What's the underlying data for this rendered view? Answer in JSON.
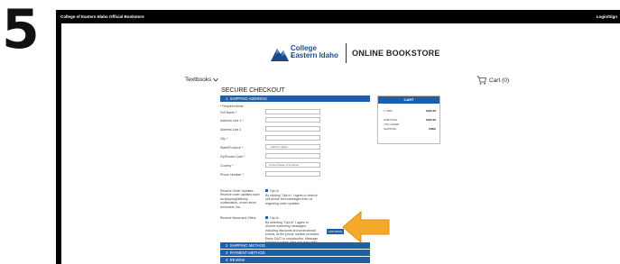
{
  "step_number": "5",
  "topbar": {
    "store_name": "College of Eastern Idaho Official Bookstore",
    "login_label": "Login/Sign"
  },
  "header": {
    "college_line1": "College",
    "college_of": "of",
    "college_line2": "Eastern Idaho",
    "store_title": "ONLINE BOOKSTORE"
  },
  "nav": {
    "textbooks_label": "Textbooks",
    "textbooks_chevron": "chevron-down-icon",
    "cart_label": "Cart (0)",
    "cart_icon": "cart-icon"
  },
  "checkout": {
    "title": "SECURE CHECKOUT",
    "sections": {
      "shipping_address": "1. SHIPPING ADDRESS",
      "shipping_method": "2. SHIPPING METHOD",
      "payment_method": "3. PAYMENT METHOD",
      "review": "4. REVIEW"
    },
    "required_note": "* Required fields",
    "fields": [
      {
        "label": "Full Name *",
        "value": ""
      },
      {
        "label": "Address Line 1 *",
        "value": ""
      },
      {
        "label": "Address Line 2",
        "value": ""
      },
      {
        "label": "City *",
        "value": ""
      },
      {
        "label": "State/Province *",
        "value": "- Select a State -"
      },
      {
        "label": "Zip/Postal Code *",
        "value": ""
      },
      {
        "label": "Country *",
        "value": "United States of America"
      },
      {
        "label": "Phone Number *",
        "value": ""
      }
    ],
    "order_updates": {
      "label": "Receive Order Updates",
      "sub_label": "Receive order updates such as shipping/delivery confirmation, some return reminders, etc.",
      "checkbox_label": "Opt-In",
      "description": "By clicking \"Opt-In\" I agree to receive cell phone text messages from us regarding order updates."
    },
    "news_offers": {
      "label": "Receive News and Offers",
      "checkbox_label": "Opt-In",
      "description": "By selecting \"Opt-In\" I agree to receive marketing messages, including discounts and promotional events, at the phone number provided. Reply QUIT to unsubscribe. Message frequency varies. Msg and data rates may apply."
    },
    "continue_label": "CONTINUE"
  },
  "cart_summary": {
    "title": "CART",
    "rows": [
      {
        "label": "1 ITEM",
        "value": "$180.95"
      },
      {
        "label": "SUBTOTAL",
        "value": "$180.95"
      },
      {
        "label": "YOU SAVED",
        "value": ""
      },
      {
        "label": "SHIPPING",
        "value": "FREE"
      }
    ]
  },
  "colors": {
    "brand_blue": "#1d5fa8",
    "arrow_orange": "#f4a92a",
    "frame_black": "#000000"
  }
}
